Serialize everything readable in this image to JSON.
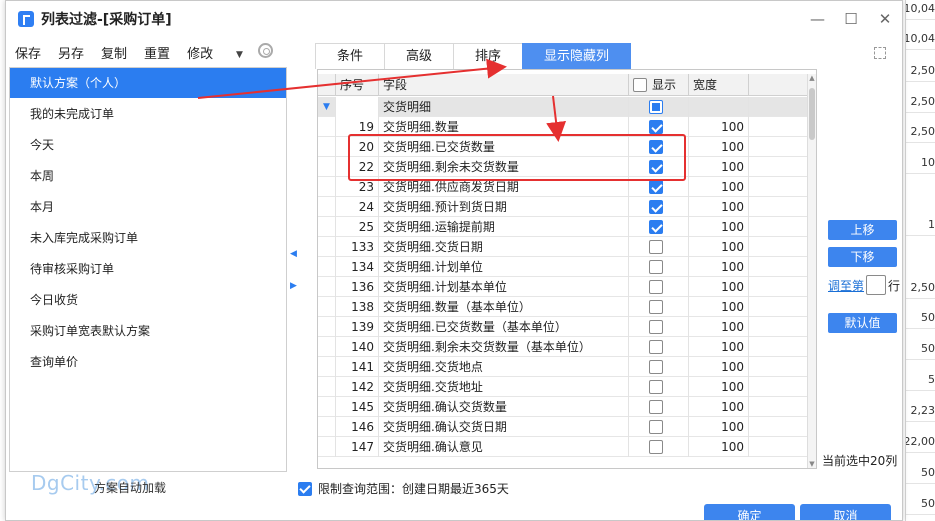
{
  "window": {
    "title": "列表过滤-[采购订单]"
  },
  "toolbar": {
    "save": "保存",
    "save_as": "另存",
    "copy": "复制",
    "reset": "重置",
    "modify": "修改"
  },
  "schemes": [
    {
      "label": "默认方案（个人）",
      "selected": true
    },
    {
      "label": "我的未完成订单",
      "selected": false
    },
    {
      "label": "今天",
      "selected": false
    },
    {
      "label": "本周",
      "selected": false
    },
    {
      "label": "本月",
      "selected": false
    },
    {
      "label": "未入库完成采购订单",
      "selected": false
    },
    {
      "label": "待审核采购订单",
      "selected": false
    },
    {
      "label": "今日收货",
      "selected": false
    },
    {
      "label": "采购订单宽表默认方案",
      "selected": false
    },
    {
      "label": "查询单价",
      "selected": false
    }
  ],
  "auto_load": "方案自动加载",
  "watermark": "DgCity.com",
  "tabs": [
    {
      "label": "条件",
      "active": false
    },
    {
      "label": "高级",
      "active": false
    },
    {
      "label": "排序",
      "active": false
    },
    {
      "label": "显示隐藏列",
      "active": true
    }
  ],
  "grid": {
    "headers": {
      "seq": "序号",
      "field": "字段",
      "show": "显示",
      "width": "宽度"
    },
    "filter_row": {
      "field": "交货明细"
    },
    "rows": [
      {
        "seq": "19",
        "field": "交货明细.数量",
        "show": true,
        "width": "100"
      },
      {
        "seq": "20",
        "field": "交货明细.已交货数量",
        "show": true,
        "width": "100"
      },
      {
        "seq": "22",
        "field": "交货明细.剩余未交货数量",
        "show": true,
        "width": "100"
      },
      {
        "seq": "23",
        "field": "交货明细.供应商发货日期",
        "show": true,
        "width": "100"
      },
      {
        "seq": "24",
        "field": "交货明细.预计到货日期",
        "show": true,
        "width": "100"
      },
      {
        "seq": "25",
        "field": "交货明细.运输提前期",
        "show": true,
        "width": "100"
      },
      {
        "seq": "133",
        "field": "交货明细.交货日期",
        "show": false,
        "width": "100"
      },
      {
        "seq": "134",
        "field": "交货明细.计划单位",
        "show": false,
        "width": "100"
      },
      {
        "seq": "136",
        "field": "交货明细.计划基本单位",
        "show": false,
        "width": "100"
      },
      {
        "seq": "138",
        "field": "交货明细.数量（基本单位）",
        "show": false,
        "width": "100"
      },
      {
        "seq": "139",
        "field": "交货明细.已交货数量（基本单位）",
        "show": false,
        "width": "100"
      },
      {
        "seq": "140",
        "field": "交货明细.剩余未交货数量（基本单位）",
        "show": false,
        "width": "100"
      },
      {
        "seq": "141",
        "field": "交货明细.交货地点",
        "show": false,
        "width": "100"
      },
      {
        "seq": "142",
        "field": "交货明细.交货地址",
        "show": false,
        "width": "100"
      },
      {
        "seq": "145",
        "field": "交货明细.确认交货数量",
        "show": false,
        "width": "100"
      },
      {
        "seq": "146",
        "field": "交货明细.确认交货日期",
        "show": false,
        "width": "100"
      },
      {
        "seq": "147",
        "field": "交货明细.确认意见",
        "show": false,
        "width": "100"
      }
    ]
  },
  "side": {
    "move_up": "上移",
    "move_down": "下移",
    "goto_prefix": "调至第",
    "goto_suffix": "行",
    "default": "默认值",
    "selected_count": "当前选中20列"
  },
  "bottom": {
    "restrict": "限制查询范围：创建日期最近365天",
    "ok": "确定",
    "cancel": "取消"
  },
  "background_cells": [
    "10,04",
    "10,04",
    "2,50",
    "2,50",
    "2,50",
    "10",
    "1",
    "2,50",
    "50",
    "50",
    "5",
    "2,23",
    "22,00",
    "50",
    "50"
  ],
  "colors": {
    "accent": "#2b7df0",
    "annotation": "#e53030"
  }
}
